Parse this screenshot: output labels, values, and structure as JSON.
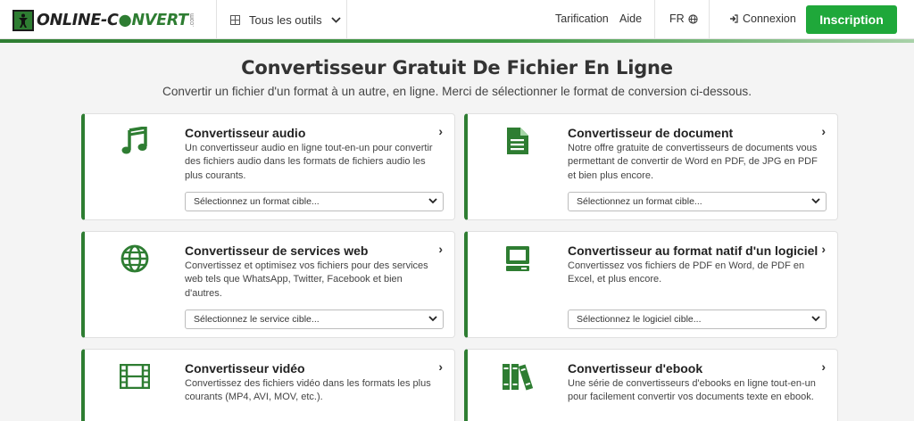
{
  "header": {
    "logo_text_a": "ONLINE-C",
    "logo_text_b": "NVERT",
    "logo_com": ".com",
    "tools_label": "Tous les outils",
    "pricing": "Tarification",
    "help": "Aide",
    "lang": "FR",
    "login": "Connexion",
    "signup": "Inscription"
  },
  "page": {
    "title": "Convertisseur Gratuit De Fichier En Ligne",
    "subtitle": "Convertir un fichier d'un format à un autre, en ligne. Merci de sélectionner le format de conversion ci-dessous."
  },
  "cards": [
    {
      "title": "Convertisseur audio",
      "desc": "Un convertisseur audio en ligne tout-en-un pour convertir des fichiers audio dans les formats de fichiers audio les plus courants.",
      "select": "Sélectionnez un format cible...",
      "icon": "music-note-icon"
    },
    {
      "title": "Convertisseur de document",
      "desc": "Notre offre gratuite de convertisseurs de documents vous permettant de convertir de Word en PDF, de JPG en PDF et bien plus encore.",
      "select": "Sélectionnez un format cible...",
      "icon": "document-icon"
    },
    {
      "title": "Convertisseur de services web",
      "desc": "Convertissez et optimisez vos fichiers pour des services web tels que WhatsApp, Twitter, Facebook et bien d'autres.",
      "select": "Sélectionnez le service cible...",
      "icon": "globe-icon"
    },
    {
      "title": "Convertisseur au format natif d'un logiciel",
      "desc": "Convertissez vos fichiers de PDF en Word, de PDF en Excel, et plus encore.",
      "select": "Sélectionnez le logiciel cible...",
      "icon": "monitor-icon"
    },
    {
      "title": "Convertisseur vidéo",
      "desc": "Convertissez des fichiers vidéo dans les formats les plus courants (MP4, AVI, MOV, etc.).",
      "icon": "film-icon"
    },
    {
      "title": "Convertisseur d'ebook",
      "desc": "Une série de convertisseurs d'ebooks en ligne tout-en-un pour facilement convertir vos documents texte en ebook.",
      "icon": "books-icon"
    }
  ],
  "colors": {
    "brand_green": "#2e7d32",
    "signup_green": "#1fa83a"
  }
}
